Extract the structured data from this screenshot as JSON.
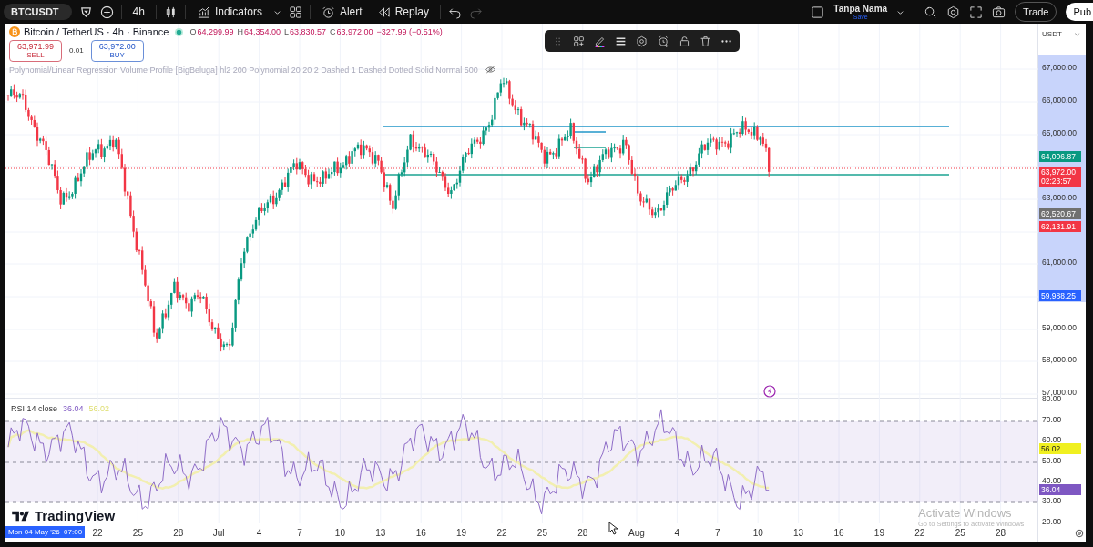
{
  "toolbar": {
    "symbol": "BTCUSDT",
    "interval": "4h",
    "indicators": "Indicators",
    "alert": "Alert",
    "replay": "Replay",
    "layout_name": "Tanpa Nama",
    "save": "Save",
    "trade": "Trade",
    "publish": "Pub"
  },
  "legend": {
    "title": "Bitcoin / TetherUS · 4h · Binance",
    "ohlc": [
      {
        "label": "O",
        "value": "64,299.99"
      },
      {
        "label": "H",
        "value": "64,354.00"
      },
      {
        "label": "L",
        "value": "63,830.57"
      },
      {
        "label": "C",
        "value": "63,972.00"
      }
    ],
    "change": "−327.99 (−0.51%)",
    "sell": {
      "price": "63,971.99",
      "label": "SELL"
    },
    "quantity": "0.01",
    "buy": {
      "price": "63,972.00",
      "label": "BUY"
    },
    "indicator": "Polynomial/Linear Regression Volume Profile [BigBeluga] hl2 200 Polynomial 20 20 2 Dashed 1 Dashed Dotted Solid Normal 500"
  },
  "price_axis": {
    "currency": "USDT",
    "labels": [
      "67,000.00",
      "66,000.00",
      "65,000.00",
      "63,000.00",
      "61,000.00",
      "59,000.00",
      "58,000.00",
      "57,000.00"
    ],
    "badges": [
      {
        "text": "64,006.87",
        "color": "#089981"
      },
      {
        "text": "63,972.00",
        "sub": "02:23:57",
        "color": "#f23645"
      },
      {
        "text": "62,520.67",
        "color": "#707070"
      },
      {
        "text": "62,131.91",
        "color": "#f23645"
      },
      {
        "text": "59,988.25",
        "color": "#2962ff"
      }
    ]
  },
  "rsi": {
    "label": "RSI 14 close",
    "value": "36.04",
    "ma_value": "56.02",
    "axis_labels": [
      "80.00",
      "70.00",
      "60.00",
      "50.00",
      "40.00",
      "30.00",
      "20.00"
    ],
    "badges": [
      {
        "text": "56.02",
        "color": "#f0f020"
      },
      {
        "text": "36.04",
        "color": "#7e57c2"
      }
    ]
  },
  "logo": "TradingView",
  "time_axis": {
    "cursor_label": "Mon 04 May '26  07:00",
    "labels": [
      "22",
      "25",
      "28",
      "Jul",
      "4",
      "7",
      "10",
      "13",
      "16",
      "19",
      "22",
      "25",
      "28",
      "Aug",
      "4",
      "7",
      "10",
      "13",
      "16",
      "19",
      "22",
      "25",
      "28"
    ]
  },
  "watermark": {
    "title": "Activate Windows",
    "subtitle": "Go to Settings to activate Windows"
  }
}
